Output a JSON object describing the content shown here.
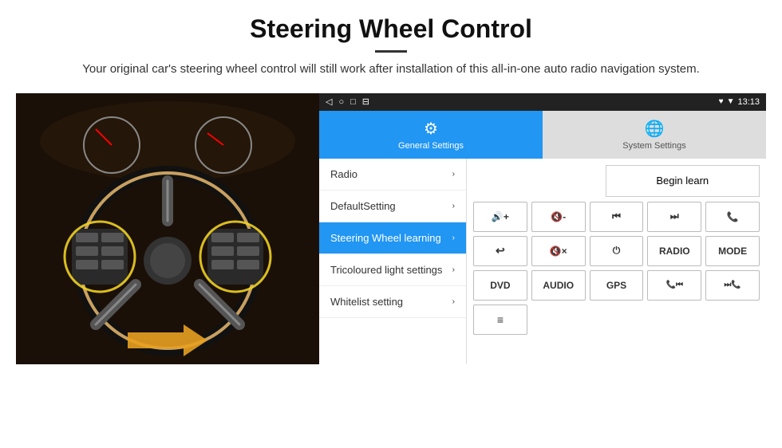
{
  "header": {
    "title": "Steering Wheel Control",
    "divider": true,
    "subtitle": "Your original car's steering wheel control will still work after installation of this all-in-one auto radio navigation system."
  },
  "status_bar": {
    "time": "13:13",
    "icons_left": [
      "◁",
      "○",
      "□",
      "⊟"
    ],
    "icons_right": [
      "♥",
      "▼",
      "13:13"
    ]
  },
  "app_bar": {
    "general_settings": {
      "label": "General Settings",
      "active": true
    },
    "system_settings": {
      "label": "System Settings",
      "active": false
    }
  },
  "menu": {
    "items": [
      {
        "id": "radio",
        "label": "Radio",
        "active": false
      },
      {
        "id": "default-setting",
        "label": "DefaultSetting",
        "active": false
      },
      {
        "id": "steering-wheel-learning",
        "label": "Steering Wheel learning",
        "active": true
      },
      {
        "id": "tricoloured-light",
        "label": "Tricoloured light settings",
        "active": false
      },
      {
        "id": "whitelist",
        "label": "Whitelist setting",
        "active": false
      }
    ]
  },
  "controls": {
    "begin_learn_label": "Begin learn",
    "buttons_row1": [
      {
        "id": "vol-up",
        "label": "🔊+",
        "title": "volume-up"
      },
      {
        "id": "vol-dn",
        "label": "🔇-",
        "title": "volume-down"
      },
      {
        "id": "prev-track",
        "label": "⏮",
        "title": "previous-track"
      },
      {
        "id": "next-track",
        "label": "⏭",
        "title": "next-track"
      },
      {
        "id": "phone",
        "label": "📞",
        "title": "phone"
      }
    ],
    "buttons_row2": [
      {
        "id": "hang-up",
        "label": "📞↩",
        "title": "hang-up"
      },
      {
        "id": "mute",
        "label": "🔇x",
        "title": "mute"
      },
      {
        "id": "power",
        "label": "⏻",
        "title": "power"
      },
      {
        "id": "radio-btn",
        "label": "RADIO",
        "title": "radio"
      },
      {
        "id": "mode",
        "label": "MODE",
        "title": "mode"
      }
    ],
    "buttons_row3": [
      {
        "id": "dvd",
        "label": "DVD",
        "title": "dvd"
      },
      {
        "id": "audio",
        "label": "AUDIO",
        "title": "audio"
      },
      {
        "id": "gps",
        "label": "GPS",
        "title": "gps"
      },
      {
        "id": "tel-prev",
        "label": "📞⏮",
        "title": "telephone-previous"
      },
      {
        "id": "tel-next",
        "label": "⏭📞",
        "title": "telephone-next"
      }
    ],
    "buttons_row4": [
      {
        "id": "list-icon",
        "label": "≡▤",
        "title": "list"
      }
    ]
  }
}
